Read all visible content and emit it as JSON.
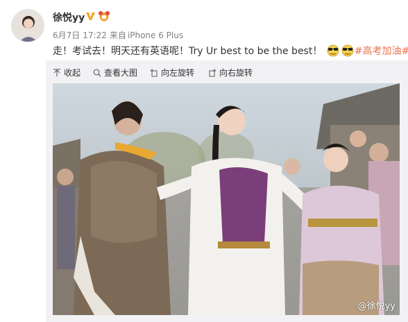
{
  "post": {
    "author": "徐悦yy",
    "date": "6月7日",
    "time": "17:22",
    "source_prefix": "来自",
    "device": "iPhone 6 Plus",
    "text": "走！考试去！明天还有英语呢！Try Ur best to be the best！",
    "hashtag": "#高考加油#"
  },
  "toolbar": {
    "collapse_label": "收起",
    "view_large_label": "查看大图",
    "rotate_left_label": "向左旋转",
    "rotate_right_label": "向右旋转"
  },
  "photo": {
    "watermark": "@徐悦yy"
  },
  "colors": {
    "hashtag": "#eb7350",
    "meta_text": "#808080",
    "panel_bg": "#f2f2f5",
    "verified_badge": "#f5a623"
  },
  "icons": [
    "verified-v-icon",
    "member-club-icon",
    "collapse-icon",
    "zoom-icon",
    "rotate-left-icon",
    "rotate-right-icon",
    "cool-face-emoji"
  ]
}
